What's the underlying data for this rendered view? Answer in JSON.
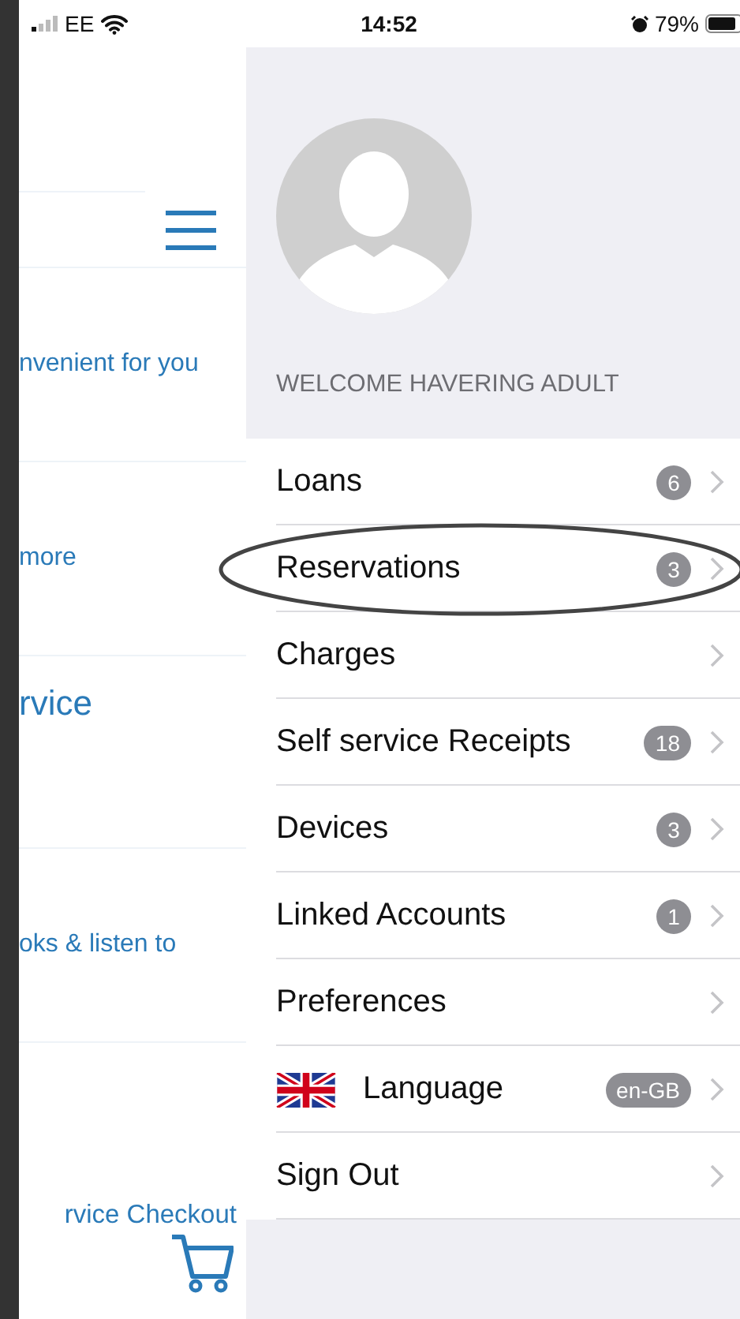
{
  "status_bar": {
    "carrier": "EE",
    "time": "14:52",
    "battery": "79%"
  },
  "background_page": {
    "items": [
      {
        "kind": "text",
        "text": "nvenient for you"
      },
      {
        "kind": "text",
        "text": "more"
      },
      {
        "kind": "heading",
        "text": "rvice"
      },
      {
        "kind": "text",
        "text": "oks & listen to"
      },
      {
        "kind": "checkout",
        "text": "rvice Checkout"
      }
    ]
  },
  "menu": {
    "welcome": "WELCOME HAVERING ADULT",
    "items": [
      {
        "label": "Loans",
        "badge": "6",
        "circled": false
      },
      {
        "label": "Reservations",
        "badge": "3",
        "circled": true
      },
      {
        "label": "Charges",
        "circled": false
      },
      {
        "label": "Self service Receipts",
        "badge": "18",
        "circled": false
      },
      {
        "label": "Devices",
        "badge": "3",
        "circled": false
      },
      {
        "label": "Linked Accounts",
        "badge": "1",
        "circled": false
      },
      {
        "label": "Preferences",
        "circled": false
      },
      {
        "label": "Language",
        "badge": "en-GB",
        "flag": true,
        "circled": false
      },
      {
        "label": "Sign Out",
        "circled": false
      }
    ]
  }
}
